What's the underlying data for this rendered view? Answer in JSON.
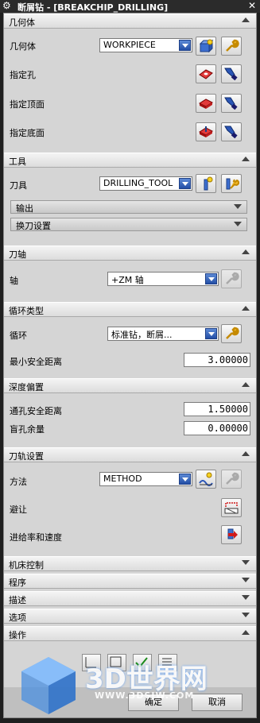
{
  "window": {
    "title": "断屑钻 - [BREAKCHIP_DRILLING]"
  },
  "geometry": {
    "header": "几何体",
    "geom_label": "几何体",
    "geom_value": "WORKPIECE",
    "hole_label": "指定孔",
    "top_label": "指定顶面",
    "bottom_label": "指定底面"
  },
  "tool": {
    "header": "工具",
    "tool_label": "刀具",
    "tool_value": "DRILLING_TOOL",
    "output_label": "输出",
    "toolchange_label": "换刀设置"
  },
  "axis": {
    "header": "刀轴",
    "axis_label": "轴",
    "axis_value": "+ZM 轴"
  },
  "cycle": {
    "header": "循环类型",
    "cycle_label": "循环",
    "cycle_value": "标准钻，断屑...",
    "min_clear_label": "最小安全距离",
    "min_clear_value": "3.00000"
  },
  "depth": {
    "header": "深度偏置",
    "through_label": "通孔安全距离",
    "through_value": "1.50000",
    "blind_label": "盲孔余量",
    "blind_value": "0.00000"
  },
  "toolpath": {
    "header": "刀轨设置",
    "method_label": "方法",
    "method_value": "METHOD",
    "avoid_label": "避让",
    "feeds_label": "进给率和速度"
  },
  "collapsed": {
    "machine_control": "机床控制",
    "program": "程序",
    "description": "描述",
    "options": "选项",
    "actions": "操作"
  },
  "footer": {
    "ok_label": "确定",
    "cancel_label": "取消"
  },
  "watermark": {
    "brand": "3D世界网",
    "url": "WWW.3DSJW.COM"
  }
}
